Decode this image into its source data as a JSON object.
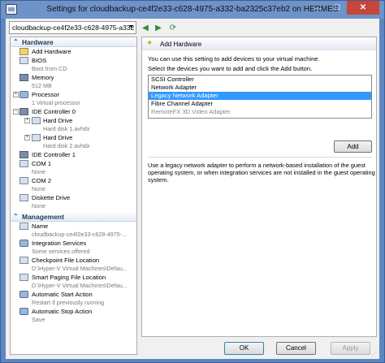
{
  "window": {
    "title": "Settings for cloudbackup-ce4f2e33-c628-4975-a332-ba2325c37eb2 on HERMES",
    "minimize": "—",
    "maximize": "☐",
    "close": "✕"
  },
  "toolbar": {
    "vm_selector_value": "cloudbackup-ce4f2e33-c628-4975-a332"
  },
  "tree": {
    "hardware_header": "Hardware",
    "management_header": "Management",
    "hardware": [
      {
        "label": "Add Hardware",
        "sub": "",
        "icon": "add-hardware-icon"
      },
      {
        "label": "BIOS",
        "sub": "Boot from CD",
        "icon": "bios-icon"
      },
      {
        "label": "Memory",
        "sub": "512 MB",
        "icon": "memory-icon"
      },
      {
        "label": "Processor",
        "sub": "1 Virtual processor",
        "icon": "processor-icon"
      },
      {
        "label": "IDE Controller 0",
        "sub": "",
        "icon": "ide-controller-icon"
      },
      {
        "label": "Hard Drive",
        "sub": "Hard disk 1.avhdx",
        "icon": "hard-drive-icon"
      },
      {
        "label": "Hard Drive",
        "sub": "Hard disk 2.avhdx",
        "icon": "hard-drive-icon"
      },
      {
        "label": "IDE Controller 1",
        "sub": "",
        "icon": "ide-controller-icon"
      },
      {
        "label": "COM 1",
        "sub": "None",
        "icon": "com-port-icon"
      },
      {
        "label": "COM 2",
        "sub": "None",
        "icon": "com-port-icon"
      },
      {
        "label": "Diskette Drive",
        "sub": "None",
        "icon": "diskette-icon"
      }
    ],
    "management": [
      {
        "label": "Name",
        "sub": "cloudbackup-ce4f2e33-c628-4975-...",
        "icon": "name-icon"
      },
      {
        "label": "Integration Services",
        "sub": "Some services offered",
        "icon": "integration-services-icon"
      },
      {
        "label": "Checkpoint File Location",
        "sub": "D:\\Hyper-V Virtual Machines\\Defau...",
        "icon": "checkpoint-icon"
      },
      {
        "label": "Smart Paging File Location",
        "sub": "D:\\Hyper-V Virtual Machines\\Defau...",
        "icon": "smart-paging-icon"
      },
      {
        "label": "Automatic Start Action",
        "sub": "Restart if previously running",
        "icon": "start-action-icon"
      },
      {
        "label": "Automatic Stop Action",
        "sub": "Save",
        "icon": "stop-action-icon"
      }
    ]
  },
  "panel": {
    "title": "Add Hardware",
    "intro": "You can use this setting to add devices to your virtual machine.",
    "instruction": "Select the devices you want to add and click the Add button.",
    "devices": [
      {
        "label": "SCSI Controller",
        "state": "normal"
      },
      {
        "label": "Network Adapter",
        "state": "normal"
      },
      {
        "label": "Legacy Network Adapter",
        "state": "selected"
      },
      {
        "label": "Fibre Channel Adapter",
        "state": "normal"
      },
      {
        "label": "RemoteFX 3D Video Adapter",
        "state": "disabled"
      }
    ],
    "add_button": "Add",
    "description": "Use a legacy network adapter to perform a network-based installation of the guest operating system, or when integration services are not installed in the guest operating system."
  },
  "footer": {
    "ok": "OK",
    "cancel": "Cancel",
    "apply": "Apply"
  },
  "colors": {
    "title_bar": "#6d93c9",
    "selection": "#3399ff",
    "close_button": "#c7463a"
  }
}
